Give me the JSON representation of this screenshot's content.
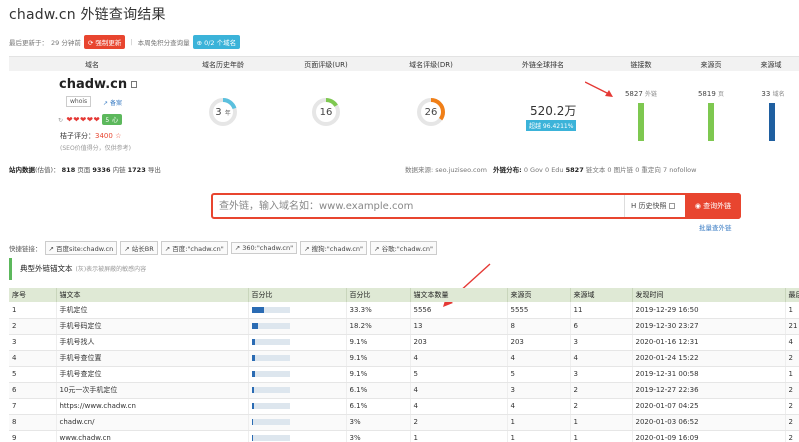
{
  "page_title": "chadw.cn 外链查询结果",
  "update": {
    "prefix": "最后更新于：",
    "ago": "29 分钟前",
    "force_btn": "强制更新",
    "free_prefix": "本周免积分查询量",
    "free_btn": "0/2 个域名"
  },
  "metrics": {
    "headers": [
      "域名",
      "域名历史年龄",
      "页面评级(UR)",
      "域名评级(DR)",
      "外链全球排名",
      "链接数",
      "来源页",
      "来源域"
    ],
    "domain": "chadw.cn",
    "whois": "whois",
    "beian": "备案",
    "hearts": "❤❤❤❤❤",
    "heart_count": "0",
    "level_badge": "5 心",
    "jz_label": "桔子评分：",
    "jz_value": "3400",
    "jz_note": "(SEO价值得分，仅供参考)",
    "age": {
      "value": "3",
      "unit": "年",
      "fraction": 0.2,
      "color": "#5bc0de"
    },
    "ur": {
      "value": "16",
      "fraction": 0.16,
      "color": "#7ec850"
    },
    "dr": {
      "value": "26",
      "fraction": 0.35,
      "color": "#f07f17"
    },
    "global_rank": "520.2万",
    "rank_badge": "超越 96.4211%",
    "links": {
      "value": "5827",
      "unit": "外链",
      "color": "#7ec850"
    },
    "ref_pages": {
      "value": "5819",
      "unit": "页",
      "color": "#7ec850"
    },
    "ref_domains": {
      "value": "33",
      "unit": "域名",
      "color": "#1f5fa0"
    }
  },
  "stats": {
    "label": "站内数据",
    "label_sub": "(估值)",
    "pages": "818",
    "pages_unit": "页面",
    "inner": "9336",
    "inner_unit": "内链",
    "outer": "1723",
    "outer_unit": "导出",
    "source": "数据来源: seo.juziseo.com",
    "dist_label": "外链分布:",
    "gov": "0",
    "gov_unit": "Gov",
    "edu": "0",
    "edu_unit": "Edu",
    "text": "5827",
    "text_unit": "链文本",
    "img": "0",
    "img_unit": "图片链",
    "redirect": "0",
    "redirect_unit": "重定向",
    "nofollow": "7",
    "nofollow_unit": "nofollow"
  },
  "search": {
    "placeholder": "查外链，输入域名如：www.example.com",
    "history": "历史快照",
    "history_icon": "H",
    "button": "查询外链",
    "batch": "批量查外链"
  },
  "quick": {
    "label": "快捷链接：",
    "links": [
      "百度site:chadw.cn",
      "站长BR",
      "百度:\"chadw.cn\"",
      "360:\"chadw.cn\"",
      "搜狗:\"chadw.cn\"",
      "谷歌:\"chadw.cn\""
    ]
  },
  "section": {
    "title": "典型外链锚文本",
    "note": "(灰)表示被屏蔽的敏感内容"
  },
  "table": {
    "headers": [
      "序号",
      "锚文本",
      "百分比",
      "百分比",
      "锚文本数量",
      "来源页",
      "来源域",
      "发现时间",
      "最后"
    ],
    "rows": [
      {
        "idx": "1",
        "anchor": "手机定位",
        "pct_num": 0.333,
        "pct": "33.3%",
        "count": "5556",
        "pages": "5555",
        "domains": "11",
        "time": "2019-12-29 16:50",
        "last": "1"
      },
      {
        "idx": "2",
        "anchor": "手机号码定位",
        "pct_num": 0.182,
        "pct": "18.2%",
        "count": "13",
        "pages": "8",
        "domains": "6",
        "time": "2019-12-30 23:27",
        "last": "21"
      },
      {
        "idx": "3",
        "anchor": "手机号找人",
        "pct_num": 0.091,
        "pct": "9.1%",
        "count": "203",
        "pages": "203",
        "domains": "3",
        "time": "2020-01-16 12:31",
        "last": "4"
      },
      {
        "idx": "4",
        "anchor": "手机号查位置",
        "pct_num": 0.091,
        "pct": "9.1%",
        "count": "4",
        "pages": "4",
        "domains": "4",
        "time": "2020-01-24 15:22",
        "last": "2"
      },
      {
        "idx": "5",
        "anchor": "手机号查定位",
        "pct_num": 0.091,
        "pct": "9.1%",
        "count": "5",
        "pages": "5",
        "domains": "3",
        "time": "2019-12-31 00:58",
        "last": "1"
      },
      {
        "idx": "6",
        "anchor": "10元一次手机定位",
        "pct_num": 0.061,
        "pct": "6.1%",
        "count": "4",
        "pages": "3",
        "domains": "2",
        "time": "2019-12-27 22:36",
        "last": "2"
      },
      {
        "idx": "7",
        "anchor": "https://www.chadw.cn",
        "pct_num": 0.061,
        "pct": "6.1%",
        "count": "4",
        "pages": "4",
        "domains": "2",
        "time": "2020-01-07 04:25",
        "last": "2"
      },
      {
        "idx": "8",
        "anchor": "chadw.cn/",
        "pct_num": 0.03,
        "pct": "3%",
        "count": "2",
        "pages": "1",
        "domains": "1",
        "time": "2020-01-03 06:52",
        "last": "2"
      },
      {
        "idx": "9",
        "anchor": "www.chadw.cn",
        "pct_num": 0.03,
        "pct": "3%",
        "count": "1",
        "pages": "1",
        "domains": "1",
        "time": "2020-01-09 16:09",
        "last": "2"
      }
    ]
  }
}
